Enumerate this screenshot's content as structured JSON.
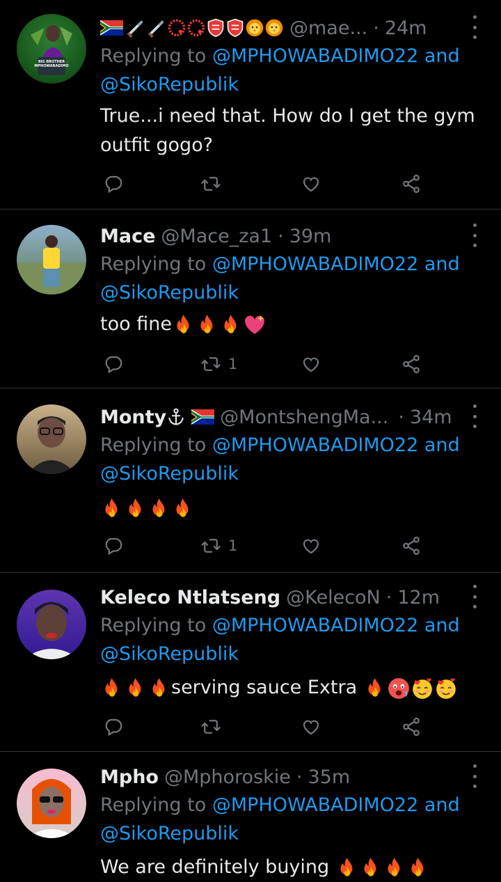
{
  "colors": {
    "background": "#000000",
    "text": "#e7e9ea",
    "muted": "#71767b",
    "link": "#1d9bf0",
    "divider": "#2f3336"
  },
  "tweets": [
    {
      "name": "",
      "handle": "@mae...",
      "time": "24m",
      "replying_prefix": "Replying to",
      "mention1": "@MPHOWABADIMO22",
      "and": "and",
      "mention2": "@SikoRepublik",
      "text_line1": "True...i need that. How do I get the gym",
      "text_line2": "outfit gogo?",
      "retweets": "",
      "avatar_caption": "BIG BROTHER MPHOWABADIMO"
    },
    {
      "name": "Mace",
      "handle": "@Mace_za1",
      "time": "39m",
      "replying_prefix": "Replying to",
      "mention1": "@MPHOWABADIMO22",
      "and": "and",
      "mention2": "@SikoRepublik",
      "text": "too fine",
      "retweets": "1"
    },
    {
      "name": "Monty",
      "handle": "@MontshengMa...",
      "time": "34m",
      "replying_prefix": "Replying to",
      "mention1": "@MPHOWABADIMO22",
      "and": "and",
      "mention2": "@SikoRepublik",
      "text": "",
      "retweets": "1"
    },
    {
      "name": "Keleco Ntlatseng",
      "handle": "@KelecoN",
      "time": "12m",
      "replying_prefix": "Replying to",
      "mention1": "@MPHOWABADIMO22",
      "and": "and",
      "mention2": "@SikoRepublik",
      "text": "serving sauce Extra",
      "retweets": ""
    },
    {
      "name": "Mpho",
      "handle": "@Mphoroskie",
      "time": "35m",
      "replying_prefix": "Replying to",
      "mention1": "@MPHOWABADIMO22",
      "and": "and",
      "mention2": "@SikoRepublik",
      "text": "We are definitely buying",
      "retweets": ""
    }
  ],
  "icons": [
    "reply-icon",
    "retweet-icon",
    "like-icon",
    "share-icon",
    "more-icon",
    "fire-emoji",
    "flag-za-emoji",
    "dagger-emoji",
    "shield-emoji",
    "lion-emoji",
    "anchor-emoji",
    "sparkling-heart-emoji",
    "hot-face-emoji",
    "smiling-hearts-emoji"
  ]
}
